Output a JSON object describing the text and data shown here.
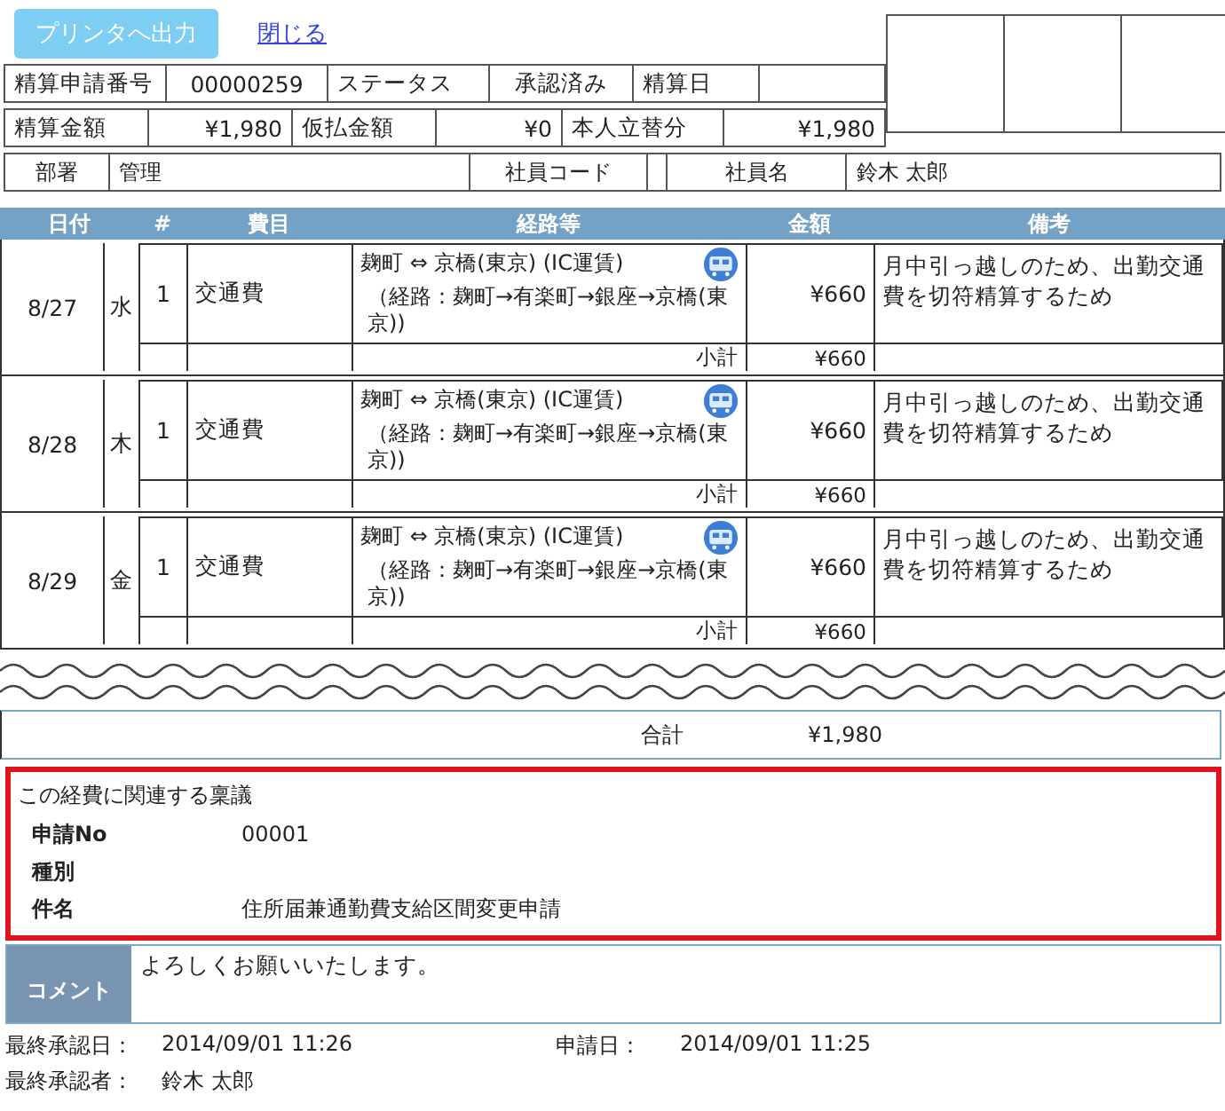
{
  "toolbar": {
    "print_button": "プリンタへ出力",
    "close_link": "閉じる"
  },
  "summary_rows": [
    [
      {
        "kind": "label",
        "text": "精算申請番号"
      },
      {
        "kind": "value",
        "text": "00000259"
      },
      {
        "kind": "label",
        "text": "ステータス"
      },
      {
        "kind": "value",
        "text": "承認済み"
      },
      {
        "kind": "label",
        "text": "精算日"
      },
      {
        "kind": "value"
      }
    ],
    [
      {
        "kind": "label",
        "text": "精算金額"
      },
      {
        "kind": "amount",
        "text": "¥1,980"
      },
      {
        "kind": "label",
        "text": "仮払金額"
      },
      {
        "kind": "amount",
        "text": "¥0"
      },
      {
        "kind": "label",
        "text": "本人立替分"
      },
      {
        "kind": "amount",
        "text": "¥1,980"
      }
    ]
  ],
  "employee": [
    {
      "label": "部署",
      "value": "管理"
    },
    {
      "label": "社員コード"
    },
    {
      "label": "社員名",
      "value": "鈴木 太郎"
    }
  ],
  "table": {
    "columns": [
      "日付",
      "#",
      "費目",
      "経路等",
      "金額",
      "備考"
    ],
    "days": [
      {
        "date": "8/27",
        "weekday": "水",
        "items": [
          {
            "no": "1",
            "category": "交通費",
            "route": "麹町 ⇔ 京橋(東京) (IC運賃)",
            "route_detail": "（経路：麹町→有楽町→銀座→京橋(東京))",
            "amount": "¥660",
            "note": "月中引っ越しのため、出勤交通費を切符精算するため"
          }
        ],
        "subtotal_label": "小計",
        "subtotal": "¥660"
      },
      {
        "date": "8/28",
        "weekday": "木",
        "items": [
          {
            "no": "1",
            "category": "交通費",
            "route": "麹町 ⇔ 京橋(東京) (IC運賃)",
            "route_detail": "（経路：麹町→有楽町→銀座→京橋(東京))",
            "amount": "¥660",
            "note": "月中引っ越しのため、出勤交通費を切符精算するため"
          }
        ],
        "subtotal_label": "小計",
        "subtotal": "¥660"
      },
      {
        "date": "8/29",
        "weekday": "金",
        "items": [
          {
            "no": "1",
            "category": "交通費",
            "route": "麹町 ⇔ 京橋(東京) (IC運賃)",
            "route_detail": "（経路：麹町→有楽町→銀座→京橋(東京))",
            "amount": "¥660",
            "note": "月中引っ越しのため、出勤交通費を切符精算するため"
          }
        ],
        "subtotal_label": "小計",
        "subtotal": "¥660"
      }
    ]
  },
  "total": {
    "label": "合計",
    "value": "¥1,980"
  },
  "related": {
    "title": "この経費に関連する稟議",
    "fields": [
      {
        "label": "申請No",
        "value": "00001"
      },
      {
        "label": "種別"
      },
      {
        "label": "件名",
        "value": "住所届兼通勤費支給区間変更申請"
      }
    ]
  },
  "comment": {
    "label": "コメント",
    "text": "よろしくお願いいたします。"
  },
  "footer": [
    {
      "label": "最終承認日：",
      "value": "2014/09/01 11:26"
    },
    {
      "label": "申請日：",
      "value": "2014/09/01 11:25"
    },
    {
      "label": "最終承認者：",
      "value": "鈴木 太郎"
    }
  ]
}
